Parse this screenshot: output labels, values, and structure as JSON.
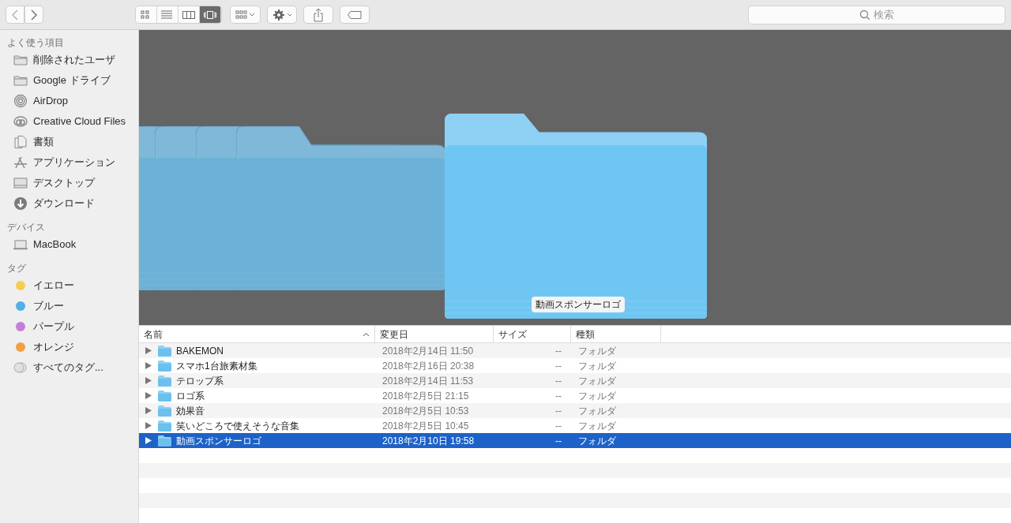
{
  "toolbar": {
    "view_modes": [
      {
        "kind": "icons",
        "selected": false
      },
      {
        "kind": "list",
        "selected": false
      },
      {
        "kind": "columns",
        "selected": false
      },
      {
        "kind": "coverflow",
        "selected": true
      }
    ],
    "search": {
      "placeholder": "検索"
    }
  },
  "sidebar": {
    "sections": [
      {
        "heading": "よく使う項目",
        "items": [
          {
            "label": "削除されたユーザ",
            "kind": "folder"
          },
          {
            "label": "Google ドライブ",
            "kind": "folder"
          },
          {
            "label": "AirDrop",
            "kind": "airdrop"
          },
          {
            "label": "Creative Cloud Files",
            "kind": "cloud"
          },
          {
            "label": "書類",
            "kind": "document"
          },
          {
            "label": "アプリケーション",
            "kind": "apps"
          },
          {
            "label": "デスクトップ",
            "kind": "desktop"
          },
          {
            "label": "ダウンロード",
            "kind": "download"
          }
        ]
      },
      {
        "heading": "デバイス",
        "items": [
          {
            "label": "MacBook",
            "kind": "laptop"
          }
        ]
      },
      {
        "heading": "タグ",
        "items": [
          {
            "label": "イエロー",
            "kind": "tag",
            "color": "#f5cd50"
          },
          {
            "label": "ブルー",
            "kind": "tag",
            "color": "#4fb0e6"
          },
          {
            "label": "パープル",
            "kind": "tag",
            "color": "#c57fd8"
          },
          {
            "label": "オレンジ",
            "kind": "tag",
            "color": "#f0a045"
          },
          {
            "label": "すべてのタグ...",
            "kind": "all_tags"
          }
        ]
      }
    ]
  },
  "coverflow": {
    "caption": "動画スポンサーロゴ"
  },
  "table": {
    "columns": [
      {
        "label": "名前",
        "sorted": true
      },
      {
        "label": "変更日",
        "sorted": false
      },
      {
        "label": "サイズ",
        "sorted": false
      },
      {
        "label": "種類",
        "sorted": false
      }
    ],
    "rows": [
      {
        "name": "BAKEMON",
        "modified": "2018年2月14日 11:50",
        "size": "--",
        "kind": "フォルダ",
        "selected": false
      },
      {
        "name": "スマホ1台旅素材集",
        "modified": "2018年2月16日 20:38",
        "size": "--",
        "kind": "フォルダ",
        "selected": false
      },
      {
        "name": "テロップ系",
        "modified": "2018年2月14日 11:53",
        "size": "--",
        "kind": "フォルダ",
        "selected": false
      },
      {
        "name": "ロゴ系",
        "modified": "2018年2月5日 21:15",
        "size": "--",
        "kind": "フォルダ",
        "selected": false
      },
      {
        "name": "効果音",
        "modified": "2018年2月5日 10:53",
        "size": "--",
        "kind": "フォルダ",
        "selected": false
      },
      {
        "name": "笑いどころで使えそうな音集",
        "modified": "2018年2月5日 10:45",
        "size": "--",
        "kind": "フォルダ",
        "selected": false
      },
      {
        "name": "動画スポンサーロゴ",
        "modified": "2018年2月10日 19:58",
        "size": "--",
        "kind": "フォルダ",
        "selected": true
      }
    ]
  }
}
